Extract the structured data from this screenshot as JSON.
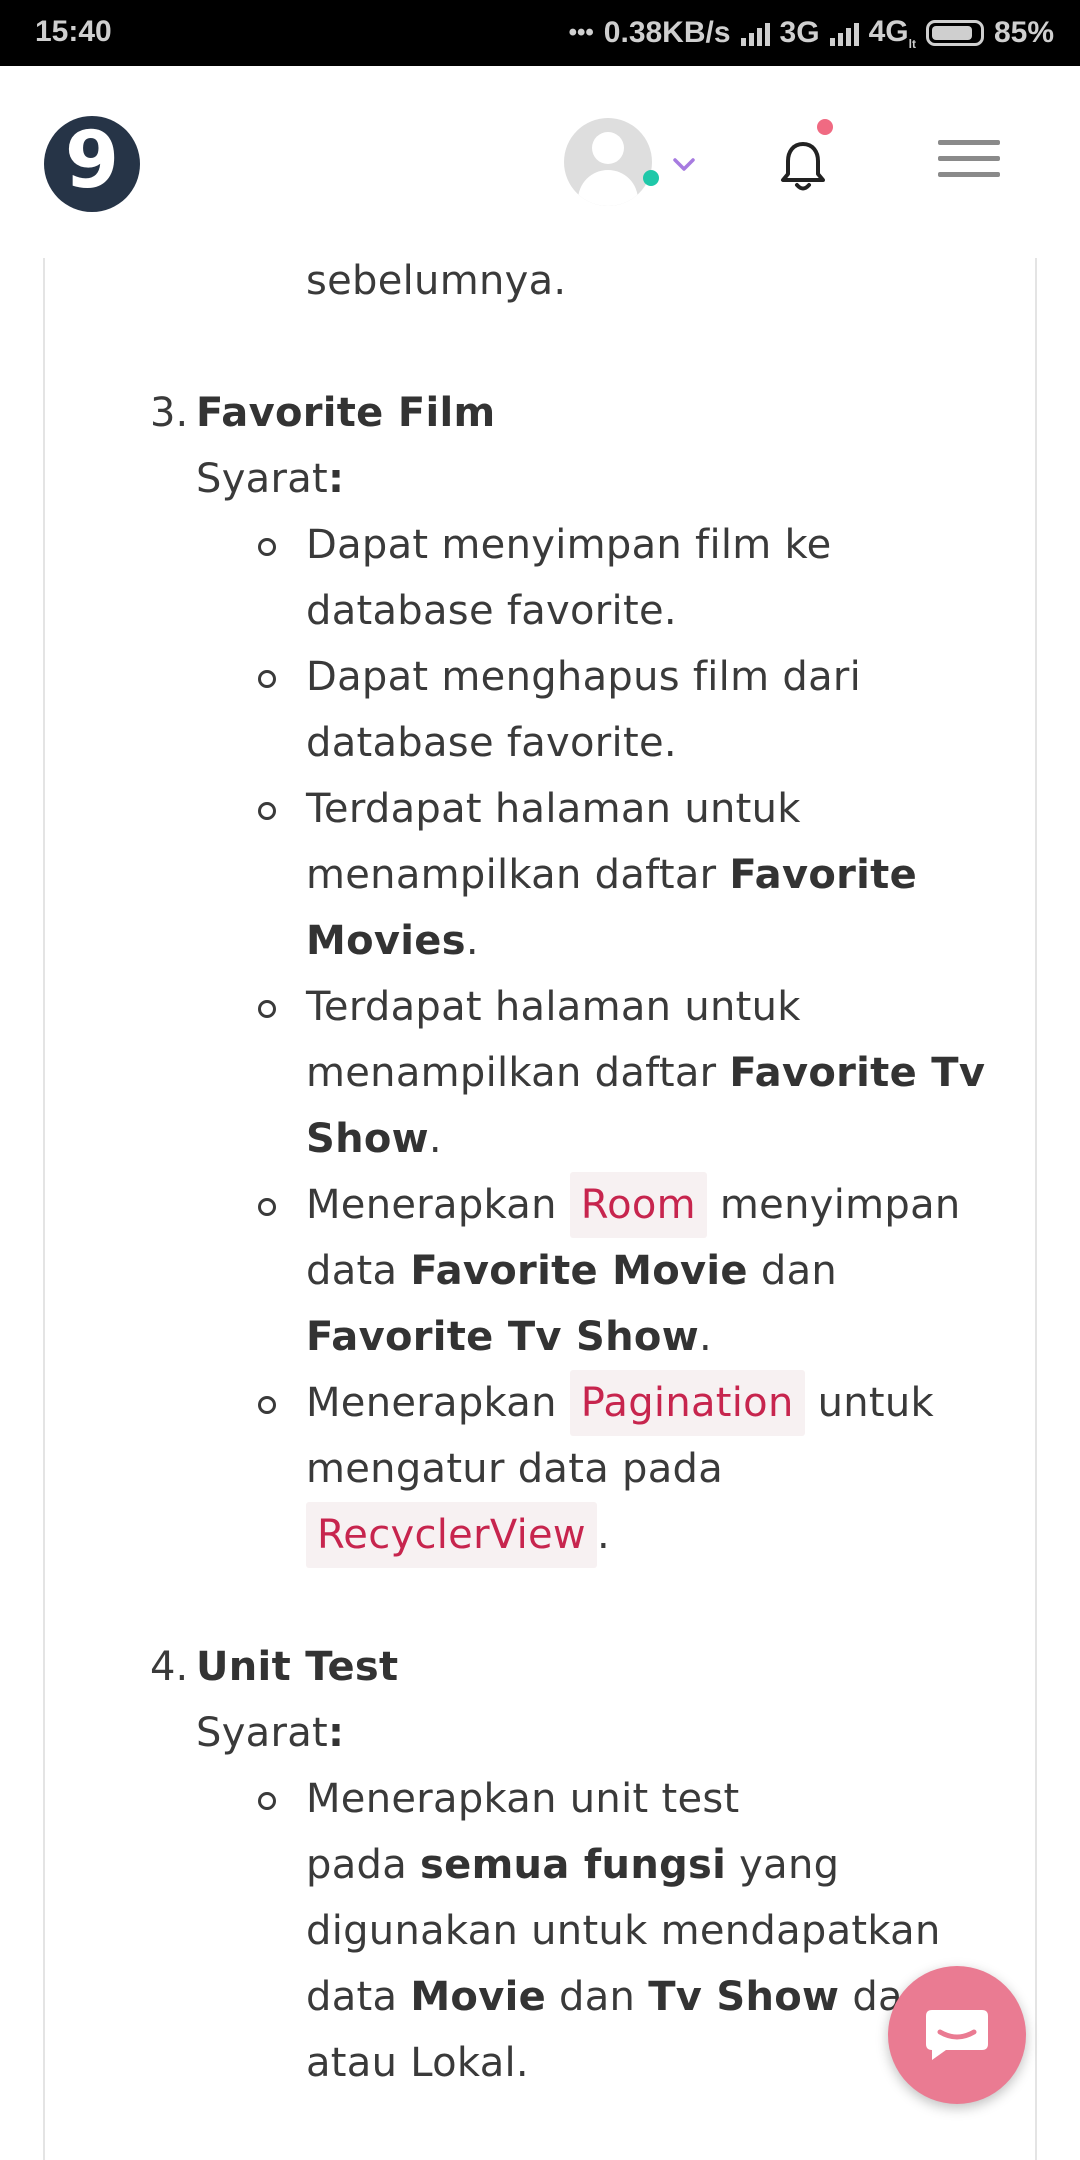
{
  "status_bar": {
    "time": "15:40",
    "dots": "•••",
    "speed": "0.38KB/s",
    "net1": "3G",
    "net2": "4G",
    "net2_sub": "lt",
    "battery": "85%"
  },
  "header": {
    "logo_text": "9"
  },
  "content": {
    "prev_tail": "sebelumnya.",
    "section3": {
      "number": "3.",
      "title": "Favorite Film",
      "req_label": "Syarat",
      "req_colon": ":",
      "b1_l1": "Dapat menyimpan film ke",
      "b1_l2": "database favorite.",
      "b2_l1": "Dapat menghapus film dari",
      "b2_l2": "database favorite.",
      "b3_l1": "Terdapat halaman untuk",
      "b3_l2_pre": "menampilkan daftar ",
      "b3_l2_bold": "Favorite",
      "b3_l3_bold": "Movies",
      "b3_l3_post": ".",
      "b4_l1": "Terdapat halaman untuk",
      "b4_l2_pre": "menampilkan daftar ",
      "b4_l2_bold": "Favorite Tv",
      "b4_l3_bold": "Show",
      "b4_l3_post": ".",
      "b5_l1_pre": "Menerapkan ",
      "b5_l1_code": "Room",
      "b5_l1_post": " menyimpan",
      "b5_l2_pre": "data ",
      "b5_l2_bold": "Favorite Movie",
      "b5_l2_post": " dan",
      "b5_l3_bold": "Favorite Tv Show",
      "b5_l3_post": ".",
      "b6_l1_pre": "Menerapkan ",
      "b6_l1_code": "Pagination",
      "b6_l1_post": " untuk",
      "b6_l2": "mengatur data pada",
      "b6_l3_code": "RecyclerView",
      "b6_l3_post": "."
    },
    "section4": {
      "number": "4.",
      "title": "Unit Test",
      "req_label": "Syarat",
      "req_colon": ":",
      "b1_l1": "Menerapkan unit test",
      "b1_l2_pre": "pada ",
      "b1_l2_bold": "semua fungsi",
      "b1_l2_post": " yang",
      "b1_l3": "digunakan untuk mendapatkan",
      "b1_l4_pre": "data ",
      "b1_l4_bold1": "Movie",
      "b1_l4_mid": " dan ",
      "b1_l4_bold2": "Tv Show",
      "b1_l4_post": " dari",
      "b1_l5": "atau Lokal."
    }
  },
  "icons": {
    "logo": "logo-icon",
    "avatar": "avatar-icon",
    "chevron": "chevron-down-icon",
    "bell": "bell-icon",
    "menu": "hamburger-menu-icon",
    "chat": "chat-icon"
  },
  "colors": {
    "accent_pink": "#ea7b92",
    "online_green": "#1fc8a9",
    "code_red": "#c7254e",
    "logo_navy": "#263447",
    "chevron_purple": "#a77be0"
  }
}
